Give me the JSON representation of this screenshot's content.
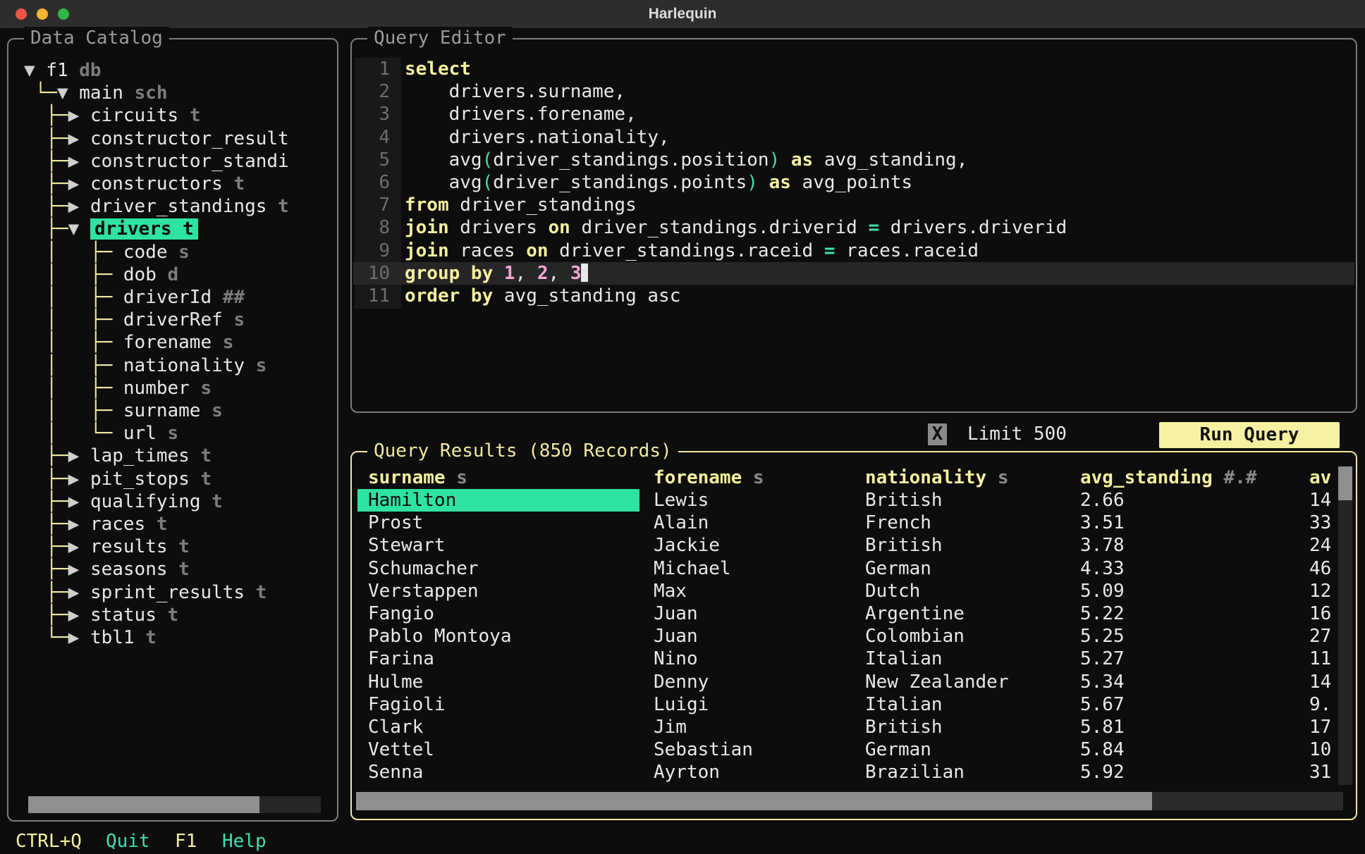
{
  "titlebar": {
    "title": "Harlequin"
  },
  "catalog": {
    "title": "Data Catalog",
    "tree": [
      {
        "guide": "",
        "arrow": "▼",
        "name": "f1",
        "type": "db"
      },
      {
        "guide": " └─",
        "arrow": "▼",
        "name": "main",
        "type": "sch"
      },
      {
        "guide": "  ├─",
        "arrow": "▶",
        "name": "circuits",
        "type": "t"
      },
      {
        "guide": "  ├─",
        "arrow": "▶",
        "name": "constructor_result",
        "type": ""
      },
      {
        "guide": "  ├─",
        "arrow": "▶",
        "name": "constructor_standi",
        "type": ""
      },
      {
        "guide": "  ├─",
        "arrow": "▶",
        "name": "constructors",
        "type": "t"
      },
      {
        "guide": "  ├─",
        "arrow": "▶",
        "name": "driver_standings",
        "type": "t"
      },
      {
        "guide": "  ├─",
        "arrow": "▼",
        "name": "drivers",
        "type": "t",
        "selected": true
      },
      {
        "guide": "  │   ├─ ",
        "arrow": "",
        "name": "code",
        "type": "s"
      },
      {
        "guide": "  │   ├─ ",
        "arrow": "",
        "name": "dob",
        "type": "d"
      },
      {
        "guide": "  │   ├─ ",
        "arrow": "",
        "name": "driverId",
        "type": "##"
      },
      {
        "guide": "  │   ├─ ",
        "arrow": "",
        "name": "driverRef",
        "type": "s"
      },
      {
        "guide": "  │   ├─ ",
        "arrow": "",
        "name": "forename",
        "type": "s"
      },
      {
        "guide": "  │   ├─ ",
        "arrow": "",
        "name": "nationality",
        "type": "s"
      },
      {
        "guide": "  │   ├─ ",
        "arrow": "",
        "name": "number",
        "type": "s"
      },
      {
        "guide": "  │   ├─ ",
        "arrow": "",
        "name": "surname",
        "type": "s"
      },
      {
        "guide": "  │   └─ ",
        "arrow": "",
        "name": "url",
        "type": "s"
      },
      {
        "guide": "  ├─",
        "arrow": "▶",
        "name": "lap_times",
        "type": "t"
      },
      {
        "guide": "  ├─",
        "arrow": "▶",
        "name": "pit_stops",
        "type": "t"
      },
      {
        "guide": "  ├─",
        "arrow": "▶",
        "name": "qualifying",
        "type": "t"
      },
      {
        "guide": "  ├─",
        "arrow": "▶",
        "name": "races",
        "type": "t"
      },
      {
        "guide": "  ├─",
        "arrow": "▶",
        "name": "results",
        "type": "t"
      },
      {
        "guide": "  ├─",
        "arrow": "▶",
        "name": "seasons",
        "type": "t"
      },
      {
        "guide": "  ├─",
        "arrow": "▶",
        "name": "sprint_results",
        "type": "t"
      },
      {
        "guide": "  ├─",
        "arrow": "▶",
        "name": "status",
        "type": "t"
      },
      {
        "guide": "  └─",
        "arrow": "▶",
        "name": "tbl1",
        "type": "t"
      }
    ]
  },
  "editor": {
    "title": "Query Editor",
    "lines": [
      {
        "num": "1",
        "cur": false,
        "tokens": [
          [
            "k",
            "select"
          ]
        ]
      },
      {
        "num": "2",
        "cur": false,
        "tokens": [
          [
            "w",
            "    drivers.surname,"
          ]
        ]
      },
      {
        "num": "3",
        "cur": false,
        "tokens": [
          [
            "w",
            "    drivers.forename,"
          ]
        ]
      },
      {
        "num": "4",
        "cur": false,
        "tokens": [
          [
            "w",
            "    drivers.nationality,"
          ]
        ]
      },
      {
        "num": "5",
        "cur": false,
        "tokens": [
          [
            "w",
            "    avg"
          ],
          [
            "p",
            "("
          ],
          [
            "w",
            "driver_standings.position"
          ],
          [
            "p",
            ")"
          ],
          [
            "w",
            " "
          ],
          [
            "k",
            "as"
          ],
          [
            "w",
            " avg_standing,"
          ]
        ]
      },
      {
        "num": "6",
        "cur": false,
        "tokens": [
          [
            "w",
            "    avg"
          ],
          [
            "p",
            "("
          ],
          [
            "w",
            "driver_standings.points"
          ],
          [
            "p",
            ")"
          ],
          [
            "w",
            " "
          ],
          [
            "k",
            "as"
          ],
          [
            "w",
            " avg_points"
          ]
        ]
      },
      {
        "num": "7",
        "cur": false,
        "tokens": [
          [
            "k",
            "from"
          ],
          [
            "w",
            " driver_standings"
          ]
        ]
      },
      {
        "num": "8",
        "cur": false,
        "tokens": [
          [
            "k",
            "join"
          ],
          [
            "w",
            " drivers "
          ],
          [
            "k",
            "on"
          ],
          [
            "w",
            " driver_standings.driverid "
          ],
          [
            "o",
            "="
          ],
          [
            "w",
            " drivers.driverid"
          ]
        ]
      },
      {
        "num": "9",
        "cur": false,
        "tokens": [
          [
            "k",
            "join"
          ],
          [
            "w",
            " races "
          ],
          [
            "k",
            "on"
          ],
          [
            "w",
            " driver_standings.raceid "
          ],
          [
            "o",
            "="
          ],
          [
            "w",
            " races.raceid"
          ]
        ]
      },
      {
        "num": "10",
        "cur": true,
        "tokens": [
          [
            "k",
            "group by"
          ],
          [
            "w",
            " "
          ],
          [
            "n",
            "1"
          ],
          [
            "w",
            ", "
          ],
          [
            "n",
            "2"
          ],
          [
            "w",
            ", "
          ],
          [
            "n",
            "3"
          ],
          [
            "cursor",
            ""
          ]
        ]
      },
      {
        "num": "11",
        "cur": false,
        "tokens": [
          [
            "k",
            "order by"
          ],
          [
            "w",
            " avg_standing asc"
          ]
        ]
      }
    ]
  },
  "controls": {
    "limit_checkbox": "X",
    "limit_label": "Limit 500",
    "run_button": "Run Query"
  },
  "results": {
    "title": "Query Results (850 Records)",
    "columns": [
      {
        "name": "surname",
        "type": "s"
      },
      {
        "name": "forename",
        "type": "s"
      },
      {
        "name": "nationality",
        "type": "s"
      },
      {
        "name": "avg_standing",
        "type": "#.#"
      },
      {
        "name": "av",
        "type": ""
      }
    ],
    "selected_row": 0,
    "rows": [
      [
        "Hamilton",
        "Lewis",
        "British",
        "2.66",
        "14"
      ],
      [
        "Prost",
        "Alain",
        "French",
        "3.51",
        "33"
      ],
      [
        "Stewart",
        "Jackie",
        "British",
        "3.78",
        "24"
      ],
      [
        "Schumacher",
        "Michael",
        "German",
        "4.33",
        "46"
      ],
      [
        "Verstappen",
        "Max",
        "Dutch",
        "5.09",
        "12"
      ],
      [
        "Fangio",
        "Juan",
        "Argentine",
        "5.22",
        "16"
      ],
      [
        "Pablo Montoya",
        "Juan",
        "Colombian",
        "5.25",
        "27"
      ],
      [
        "Farina",
        "Nino",
        "Italian",
        "5.27",
        "11"
      ],
      [
        "Hulme",
        "Denny",
        "New Zealander",
        "5.34",
        "14"
      ],
      [
        "Fagioli",
        "Luigi",
        "Italian",
        "5.67",
        "9."
      ],
      [
        "Clark",
        "Jim",
        "British",
        "5.81",
        "17"
      ],
      [
        "Vettel",
        "Sebastian",
        "German",
        "5.84",
        "10"
      ],
      [
        "Senna",
        "Ayrton",
        "Brazilian",
        "5.92",
        "31"
      ]
    ]
  },
  "footer": [
    {
      "key": "CTRL+Q",
      "label": "Quit"
    },
    {
      "key": "F1",
      "label": "Help"
    }
  ],
  "colors": {
    "background": "#0d0d0d",
    "titlebar": "#2d2d2d",
    "panel_border": "#7c7c7c",
    "focused_border": "#efe9a0",
    "selection_teal": "#2ee2a2",
    "keyword_yellow": "#f5f09e",
    "number_pink": "#f0a8d2",
    "paren_teal": "#3fe0b2",
    "run_button_bg": "#f5f1a1",
    "traffic_red": "#ee5448",
    "traffic_yellow": "#f5b52e",
    "traffic_green": "#33b648"
  }
}
